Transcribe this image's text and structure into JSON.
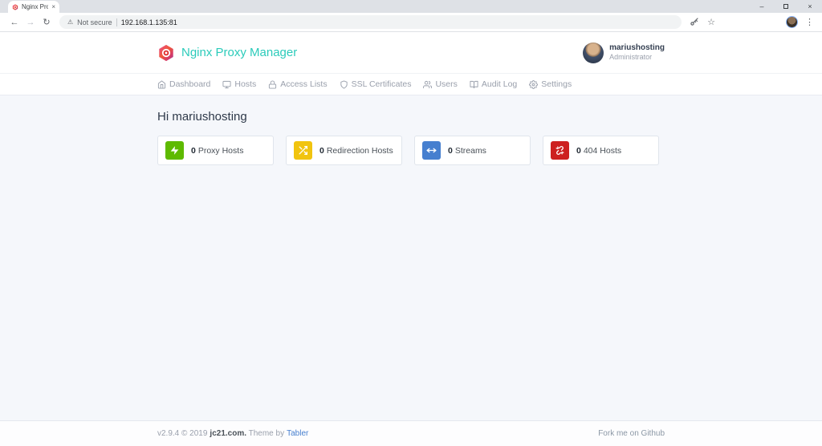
{
  "browser": {
    "tab_title": "Nginx Prox",
    "security_label": "Not secure",
    "url": "192.168.1.135:81",
    "icons": {
      "back": "←",
      "forward": "→",
      "refresh": "↻",
      "warning": "⚠",
      "star": "☆",
      "menu": "⋮",
      "minimize": "–",
      "close": "×",
      "tab_close": "×"
    }
  },
  "header": {
    "app_title": "Nginx Proxy Manager",
    "user_name": "mariushosting",
    "user_role": "Administrator"
  },
  "nav": {
    "items": [
      {
        "label": "Dashboard",
        "icon": "home-icon"
      },
      {
        "label": "Hosts",
        "icon": "monitor-icon"
      },
      {
        "label": "Access Lists",
        "icon": "lock-icon"
      },
      {
        "label": "SSL Certificates",
        "icon": "shield-icon"
      },
      {
        "label": "Users",
        "icon": "users-icon"
      },
      {
        "label": "Audit Log",
        "icon": "book-icon"
      },
      {
        "label": "Settings",
        "icon": "gear-icon"
      }
    ]
  },
  "main": {
    "greeting": "Hi mariushosting",
    "cards": [
      {
        "count": "0",
        "label": "Proxy Hosts",
        "color": "#5eba00",
        "icon": "bolt-icon"
      },
      {
        "count": "0",
        "label": "Redirection Hosts",
        "color": "#f1c40f",
        "icon": "shuffle-icon"
      },
      {
        "count": "0",
        "label": "Streams",
        "color": "#467fcf",
        "icon": "arrows-horizontal-icon"
      },
      {
        "count": "0",
        "label": "404 Hosts",
        "color": "#cd201f",
        "icon": "broken-link-icon"
      }
    ]
  },
  "footer": {
    "version": "v2.9.4 © 2019",
    "company_link": "jc21.com.",
    "theme_prefix": "Theme by",
    "theme_link": "Tabler",
    "github_link": "Fork me on Github"
  },
  "colors": {
    "brand_teal": "#2bcbba",
    "body_bg": "#f5f7fb",
    "muted_text": "#9aa0ac"
  }
}
